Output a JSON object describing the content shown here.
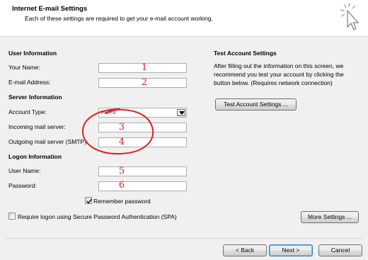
{
  "header": {
    "title": "Internet E-mail Settings",
    "subtitle": "Each of these settings are required to get your e-mail account working."
  },
  "user_info": {
    "heading": "User Information",
    "name_label": "Your Name:",
    "email_label": "E-mail Address:"
  },
  "server_info": {
    "heading": "Server Information",
    "account_type_label": "Account Type:",
    "account_type_value": "POP3",
    "incoming_label": "Incoming mail server:",
    "outgoing_label": "Outgoing mail server (SMTP):"
  },
  "logon_info": {
    "heading": "Logon Information",
    "user_name_label": "User Name:",
    "password_label": "Password:",
    "remember_password_label": "Remember password",
    "remember_password_checked": true,
    "spa_label": "Require logon using Secure Password Authentication (SPA)",
    "spa_checked": false
  },
  "markers": [
    "1",
    "2",
    "3",
    "4",
    "5",
    "6"
  ],
  "test_settings": {
    "heading": "Test Account Settings",
    "description_1": "After filling out the information on this screen, we",
    "description_2": "recommend you test your account by clicking the",
    "description_3": "button below. (Requires network connection)",
    "button_label": "Test Account Settings ..."
  },
  "buttons": {
    "more_settings": "More Settings ...",
    "back": "< Back",
    "next": "Next >",
    "cancel": "Cancel"
  },
  "colors": {
    "marker": "#d42020",
    "annotation_circle": "#e02020"
  },
  "icons": {
    "header": "cursor-click-icon"
  }
}
